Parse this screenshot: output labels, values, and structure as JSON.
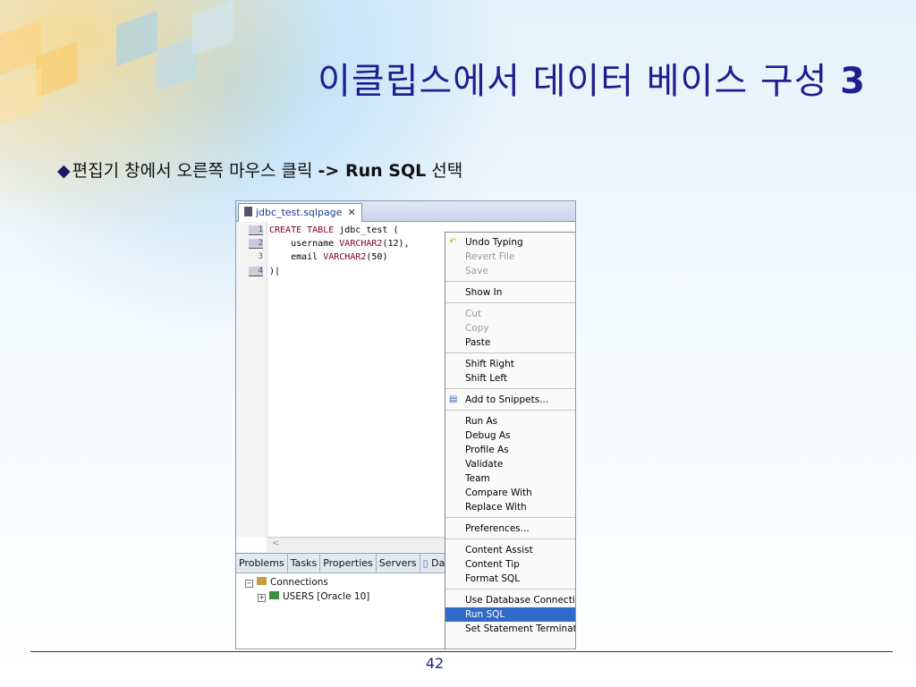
{
  "slide": {
    "title_text": "이클립스에서 데이터 베이스 구성 ",
    "title_number": "3",
    "bullet_text": "편집기 창에서 오른쪽 마우스 클릭 ",
    "bullet_bold": "-> Run SQL",
    "bullet_tail": " 선택",
    "page_number": "42",
    "colors": {
      "title": "#1f1f8f",
      "selection": "#3169c6"
    }
  },
  "eclipse": {
    "editor_tab": "jdbc_test.sqlpage",
    "line_numbers": [
      "1",
      "2",
      "3",
      "4"
    ],
    "code": {
      "line1_kw": "CREATE TABLE",
      "line1_rest": " jdbc_test (",
      "line2_name": "    username ",
      "line2_type": "VARCHAR2",
      "line2_rest": "(12),",
      "line3_name": "    email ",
      "line3_type": "VARCHAR2",
      "line3_rest": "(50)",
      "line4": ")|"
    },
    "scroll_arrow": "<",
    "view_tabs": [
      "Problems",
      "Tasks",
      "Properties",
      "Servers",
      "Da"
    ],
    "tree": {
      "connections": "Connections",
      "users": "USERS [Oracle 10]"
    },
    "context_menu": {
      "undo_typing": "Undo Typing",
      "revert_file": "Revert File",
      "save": "Save",
      "show_in": "Show In",
      "cut": "Cut",
      "copy": "Copy",
      "paste": "Paste",
      "shift_right": "Shift Right",
      "shift_left": "Shift Left",
      "add_to_snippets": "Add to Snippets...",
      "run_as": "Run As",
      "debug_as": "Debug As",
      "profile_as": "Profile As",
      "validate": "Validate",
      "team": "Team",
      "compare_with": "Compare With",
      "replace_with": "Replace With",
      "preferences": "Preferences...",
      "content_assist": "Content Assist",
      "content_tip": "Content Tip",
      "format_sql": "Format SQL",
      "use_database_connection": "Use Database Connectio",
      "run_sql": "Run SQL",
      "set_statement_terminator": "Set Statement Terminato"
    }
  }
}
